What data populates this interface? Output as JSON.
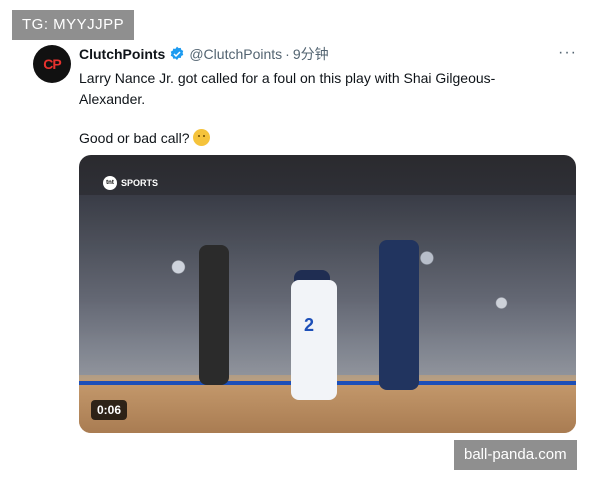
{
  "overlay": {
    "tg_tag": "TG: MYYJJPP",
    "watermark": "ball-panda.com"
  },
  "tweet": {
    "display_name": "ClutchPoints",
    "handle": "@ClutchPoints",
    "separator": "·",
    "time": "9分钟",
    "more": "···",
    "avatar_text": "CP",
    "text_line1": "Larry Nance Jr. got called for a foul on this play with Shai Gilgeous-Alexander.",
    "text_line2": "Good or bad call?",
    "emoji": "thinking-face-icon"
  },
  "video": {
    "broadcaster": "SPORTS",
    "broadcaster_logo": "tnt",
    "duration": "0:06",
    "jersey_number": "2"
  },
  "colors": {
    "verified": "#1d9bf0",
    "text": "#0f1419",
    "muted": "#536471",
    "overlay_bg": "#8f8f8f"
  }
}
